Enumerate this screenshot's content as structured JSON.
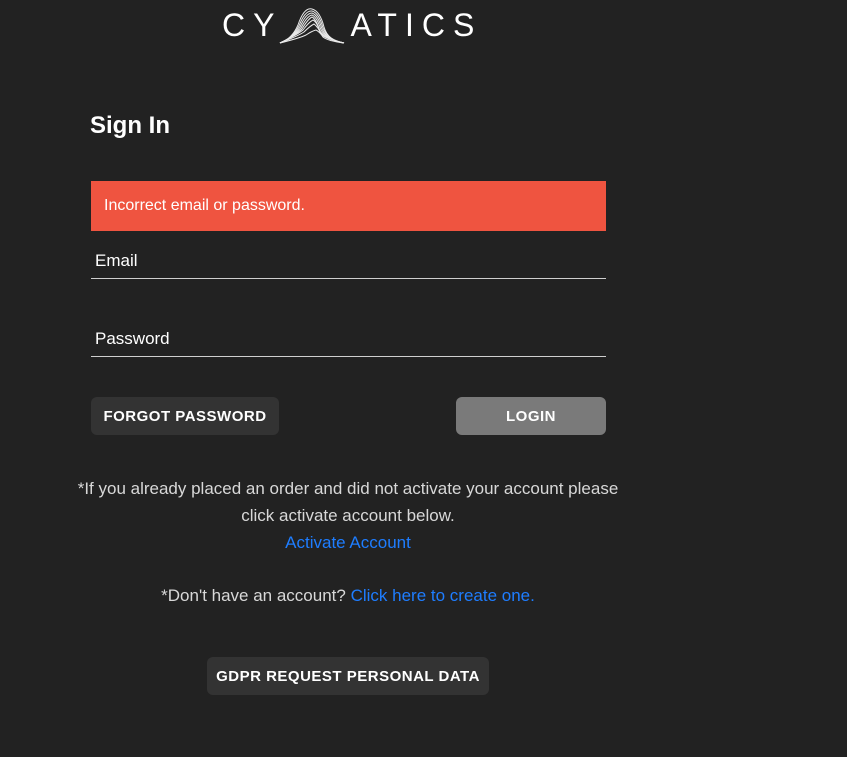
{
  "brand": {
    "logo_left": "CY",
    "logo_right": "ATICS"
  },
  "signin": {
    "title": "Sign In",
    "error_message": "Incorrect email or password.",
    "email_placeholder": "Email",
    "password_placeholder": "Password",
    "forgot_label": "FORGOT PASSWORD",
    "login_label": "LOGIN"
  },
  "notes": {
    "activate_line1": "*If you already placed an order and did not activate your account please",
    "activate_line2": "click activate account below.",
    "activate_link": "Activate Account",
    "signup_prefix": "*Don't have an account?",
    "signup_link": "Click here to create one."
  },
  "gdpr": {
    "label": "GDPR REQUEST PERSONAL DATA"
  },
  "colors": {
    "background": "#222222",
    "error": "#ef5440",
    "link": "#1e7dff",
    "login_button": "#7a7a7a",
    "secondary_button": "#333333"
  }
}
